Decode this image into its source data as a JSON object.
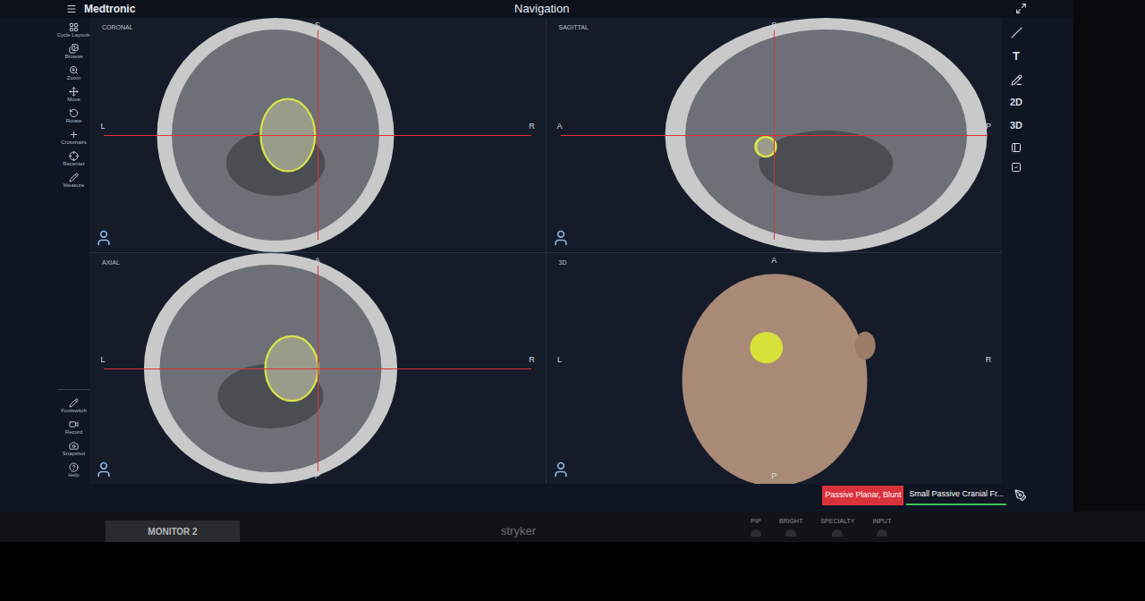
{
  "header": {
    "brand": "Medtronic",
    "title": "Navigation"
  },
  "left_toolbar": {
    "top": [
      {
        "label": "Cycle Layouts"
      },
      {
        "label": "Browse"
      },
      {
        "label": "Zoom"
      },
      {
        "label": "Move"
      },
      {
        "label": "Rotate"
      },
      {
        "label": "Crosshairs"
      },
      {
        "label": "Recenter"
      },
      {
        "label": "Measure"
      }
    ],
    "bottom": [
      {
        "label": "Footswitch"
      },
      {
        "label": "Record"
      },
      {
        "label": "Snapshot"
      },
      {
        "label": "Help"
      }
    ]
  },
  "viewports": [
    {
      "label": "CORONAL",
      "kind": "mri",
      "markers": [
        {
          "text": "S",
          "side": "top"
        },
        {
          "text": "L",
          "side": "left"
        },
        {
          "text": "R",
          "side": "right"
        }
      ]
    },
    {
      "label": "SAGITTAL",
      "kind": "mri",
      "markers": [
        {
          "text": "S",
          "side": "top"
        },
        {
          "text": "A",
          "side": "left"
        },
        {
          "text": "P",
          "side": "right"
        }
      ]
    },
    {
      "label": "AXIAL",
      "kind": "mri",
      "markers": [
        {
          "text": "A",
          "side": "top"
        },
        {
          "text": "L",
          "side": "left"
        },
        {
          "text": "R",
          "side": "right"
        },
        {
          "text": "P",
          "side": "bottom"
        }
      ]
    },
    {
      "label": "3D",
      "kind": "surface",
      "markers": [
        {
          "text": "A",
          "side": "top"
        },
        {
          "text": "R",
          "side": "right"
        },
        {
          "text": "L",
          "side": "left"
        },
        {
          "text": "P",
          "side": "bottom"
        }
      ]
    }
  ],
  "right_toolbar": [
    "T",
    "2D",
    "3D"
  ],
  "status_bar": {
    "tools": [
      {
        "label": "Passive Planar, Blunt",
        "kind": "filled",
        "color": "#d9323c"
      },
      {
        "label": "Small Passive Cranial Fr...",
        "kind": "underline",
        "color": "#3cc45a"
      }
    ]
  },
  "bezel": {
    "monitor_label": "MONITOR 2",
    "brand": "stryker",
    "buttons": [
      "PIP",
      "BRIGHT",
      "SPECIALTY",
      "INPUT"
    ]
  }
}
